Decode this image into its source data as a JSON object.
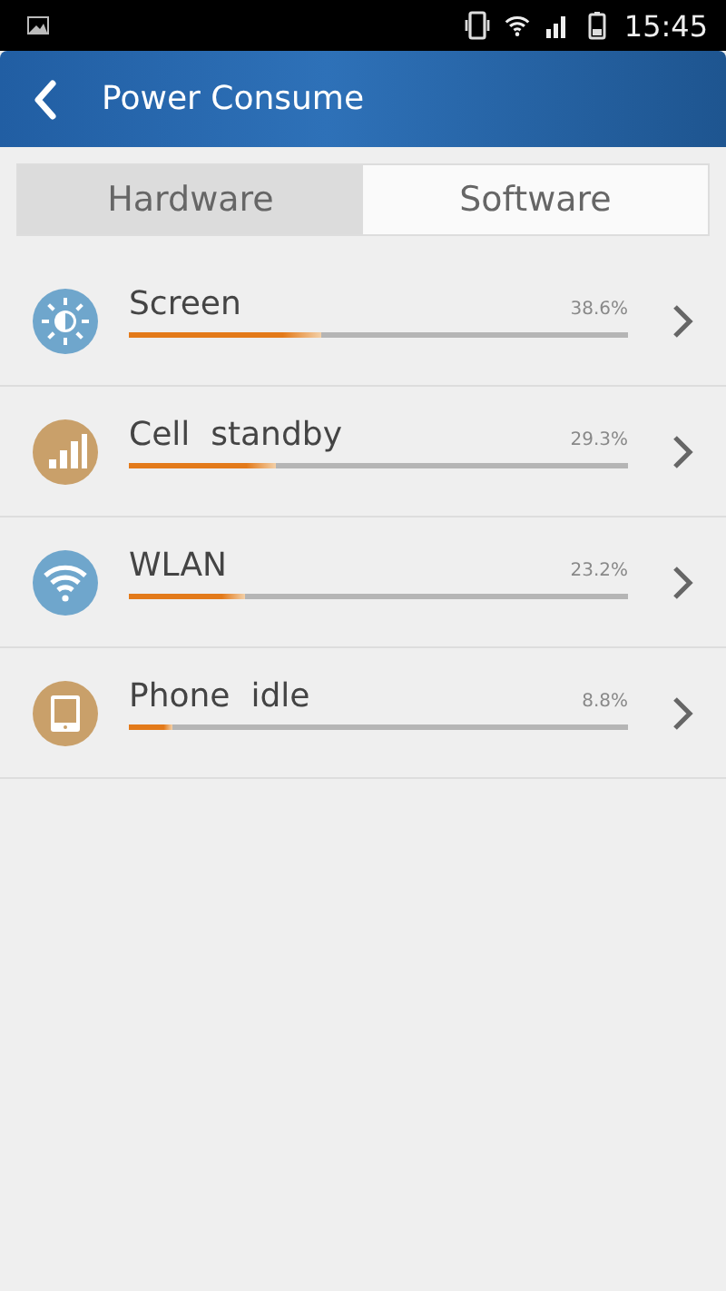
{
  "status_bar": {
    "time": "15:45"
  },
  "header": {
    "title": "Power Consume"
  },
  "tabs": [
    {
      "label": "Hardware",
      "selected": true
    },
    {
      "label": "Software",
      "selected": false
    }
  ],
  "items": [
    {
      "kind": "screen",
      "color": "#6fa6cc",
      "name": "Screen",
      "reading": "38.6%",
      "level": 0.386
    },
    {
      "kind": "cell",
      "color": "#c9a06a",
      "name": "Cell  standby",
      "reading": "29.3%",
      "level": 0.293
    },
    {
      "kind": "wlan",
      "color": "#6fa6cc",
      "name": "WLAN",
      "reading": "23.2%",
      "level": 0.232
    },
    {
      "kind": "idle",
      "color": "#c9a06a",
      "name": "Phone  idle",
      "reading": "8.8%",
      "level": 0.088
    }
  ]
}
